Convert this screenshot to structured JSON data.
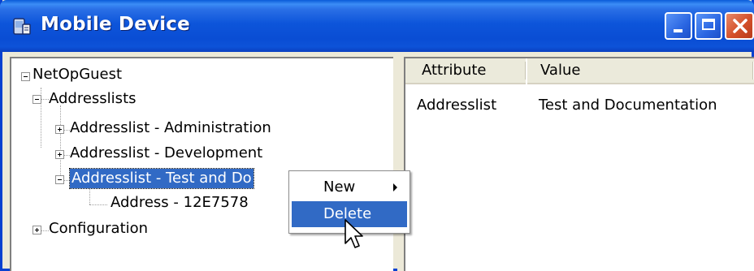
{
  "window": {
    "title": "Mobile Device"
  },
  "tree": {
    "root": "NetOpGuest",
    "addresslists": "Addresslists",
    "item_admin": "Addresslist - Administration",
    "item_dev": "Addresslist -  Development",
    "item_test": "Addresslist - Test and Do",
    "address": "Address - 12E7578",
    "configuration": "Configuration"
  },
  "list": {
    "headers": {
      "attribute": "Attribute",
      "value": "Value"
    },
    "rows": [
      {
        "attribute": "Addresslist",
        "value": "Test and Documentation"
      }
    ]
  },
  "context_menu": {
    "items": [
      {
        "label": "New",
        "has_submenu": true
      },
      {
        "label": "Delete",
        "highlighted": true
      }
    ]
  },
  "colors": {
    "title_blue": "#0a4dd4",
    "selection": "#316ac5",
    "close_red": "#d4502a"
  }
}
